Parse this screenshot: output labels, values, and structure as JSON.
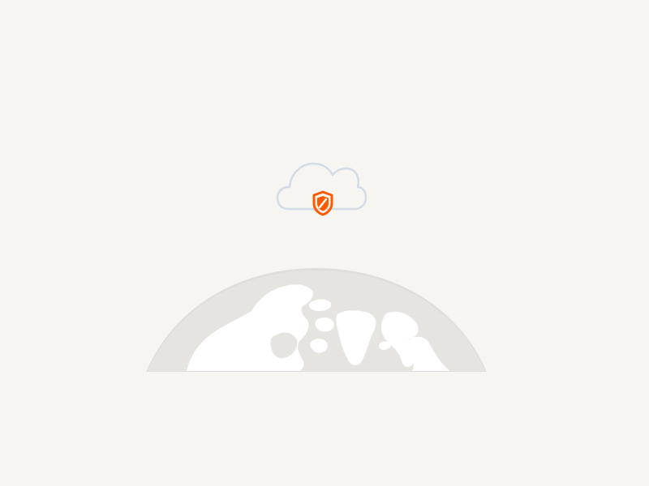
{
  "screen": {
    "background_color": "#f6f5f2"
  },
  "cloud_icon": {
    "icon": "cloud-icon",
    "stroke_color": "#d3dbe6",
    "fill_color": "#f6f5f2"
  },
  "shield_icon": {
    "icon": "shield-icon",
    "color": "#ff5a00"
  },
  "globe": {
    "icon": "globe-icon",
    "ocean_color": "#e6e4e1",
    "land_color": "#ffffff",
    "rim_color": "#e0dedb"
  }
}
